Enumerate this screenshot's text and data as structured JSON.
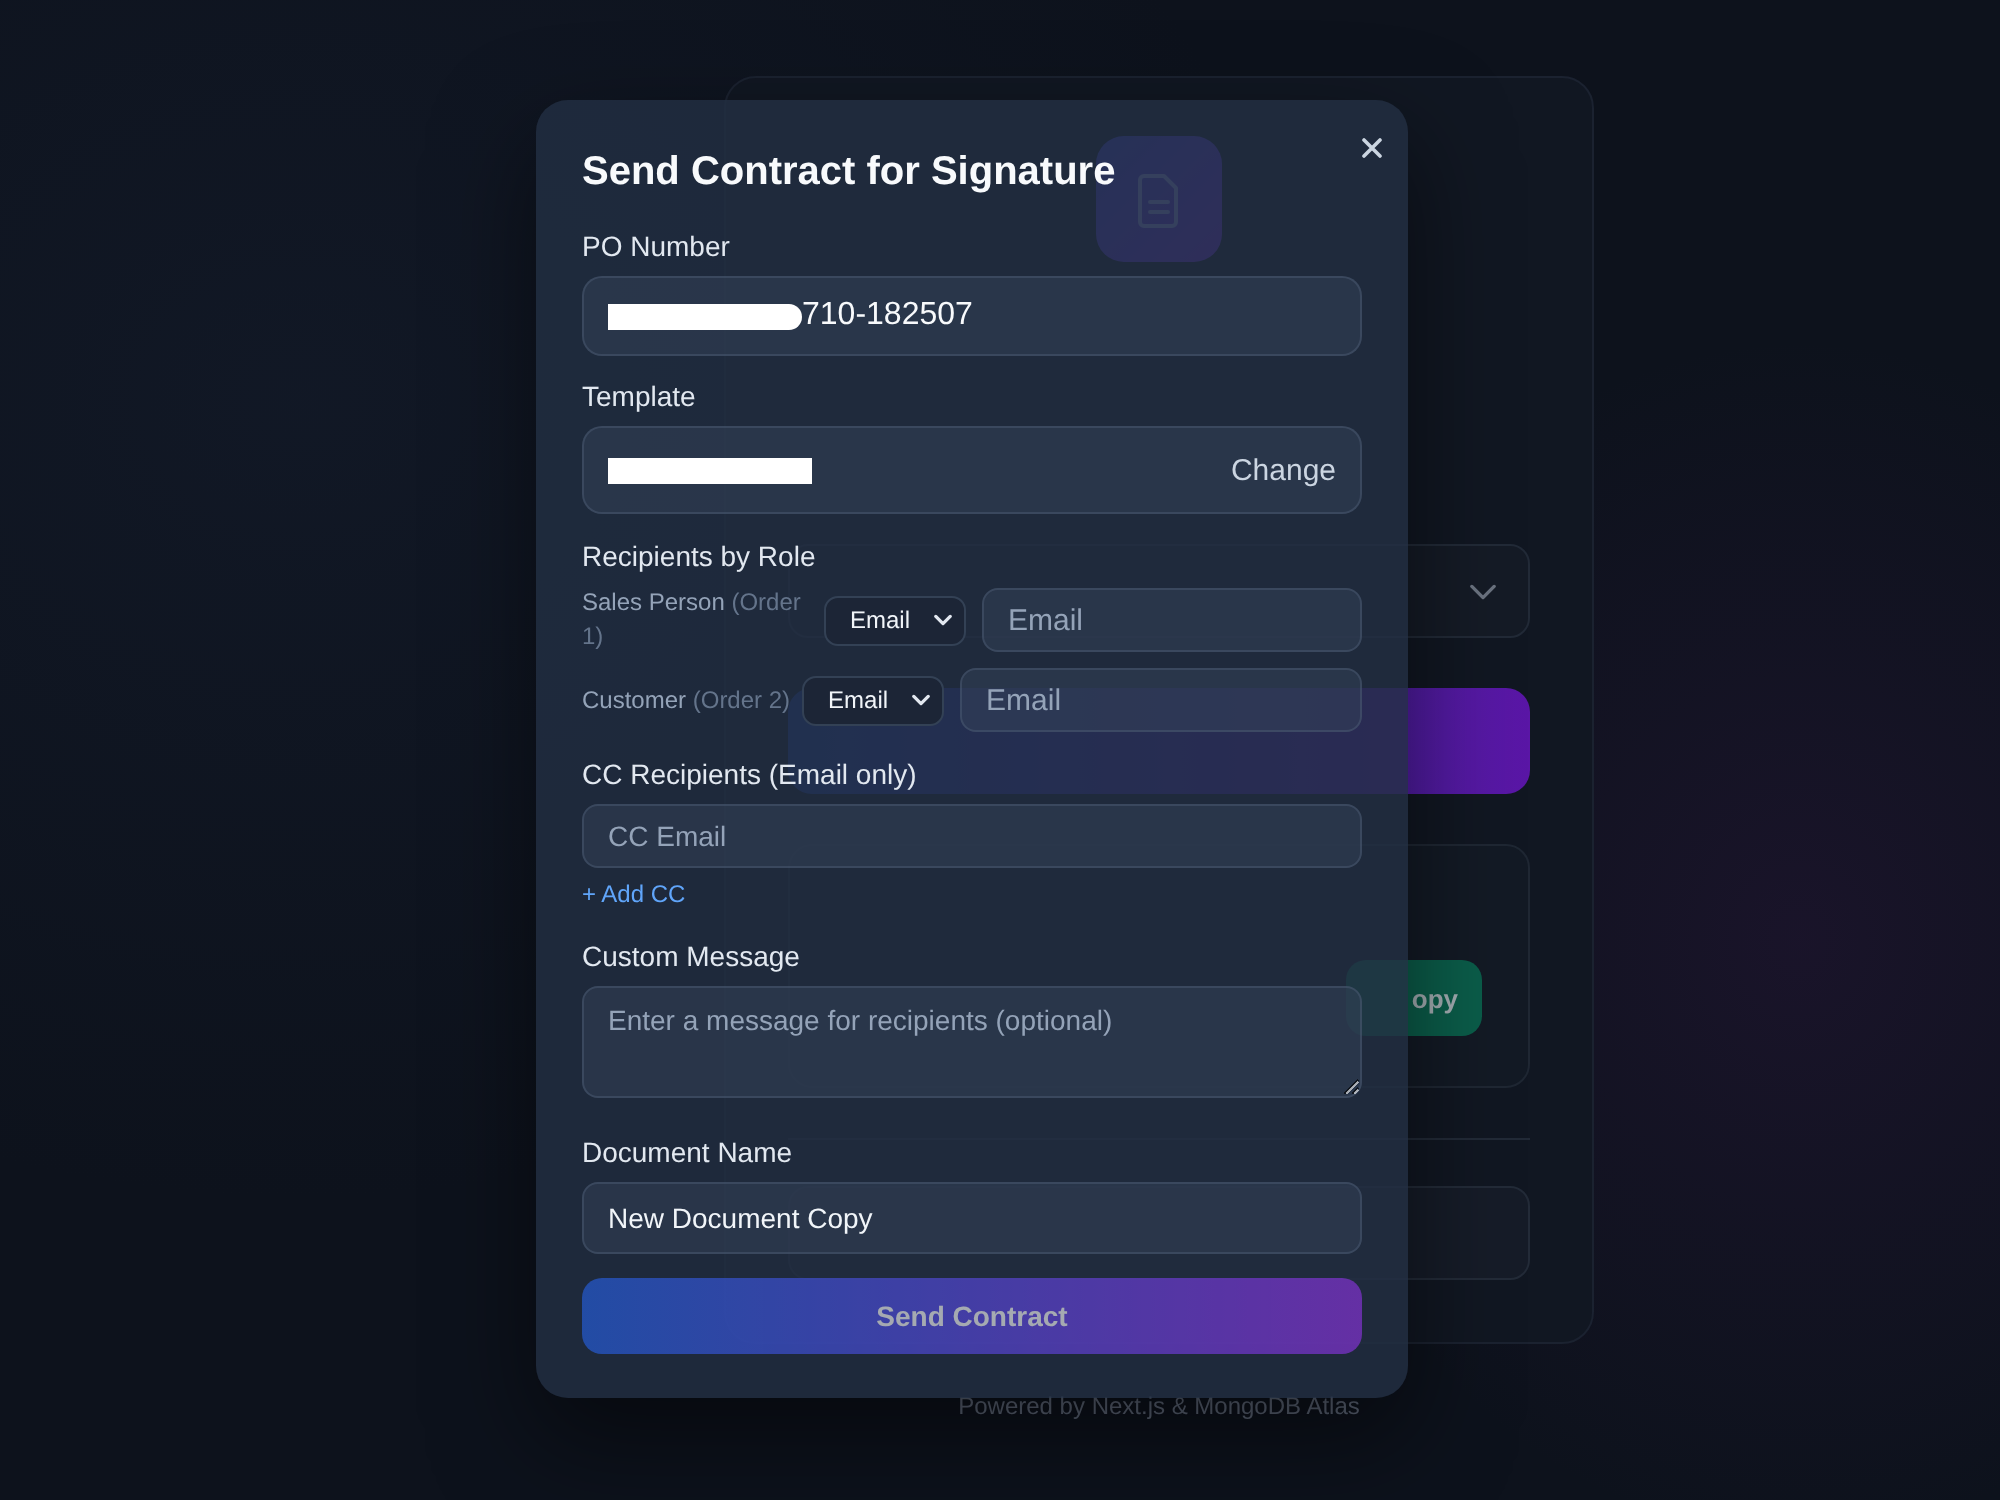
{
  "background_page": {
    "generated_po": {
      "copy_button": "opy"
    },
    "footer": "Powered by Next.js & MongoDB Atlas"
  },
  "modal": {
    "title": "Send Contract for Signature",
    "po_number": {
      "label": "PO Number",
      "value": "710-182507",
      "redacted": true
    },
    "template": {
      "label": "Template",
      "redacted": true,
      "action": "Change"
    },
    "recipients": {
      "label": "Recipients by Role",
      "rows": [
        {
          "role": "Sales Person",
          "order": "(Order 1)",
          "method": "Email",
          "placeholder": "Email"
        },
        {
          "role": "Customer",
          "order": "(Order 2)",
          "method": "Email",
          "placeholder": "Email"
        }
      ]
    },
    "cc": {
      "label": "CC Recipients (Email only)",
      "placeholder": "CC Email",
      "add_link": "+ Add CC"
    },
    "message": {
      "label": "Custom Message",
      "placeholder": "Enter a message for recipients (optional)"
    },
    "document_name": {
      "label": "Document Name",
      "value": "New Document Copy"
    },
    "submit": {
      "label": "Send Contract",
      "disabled": true
    }
  }
}
